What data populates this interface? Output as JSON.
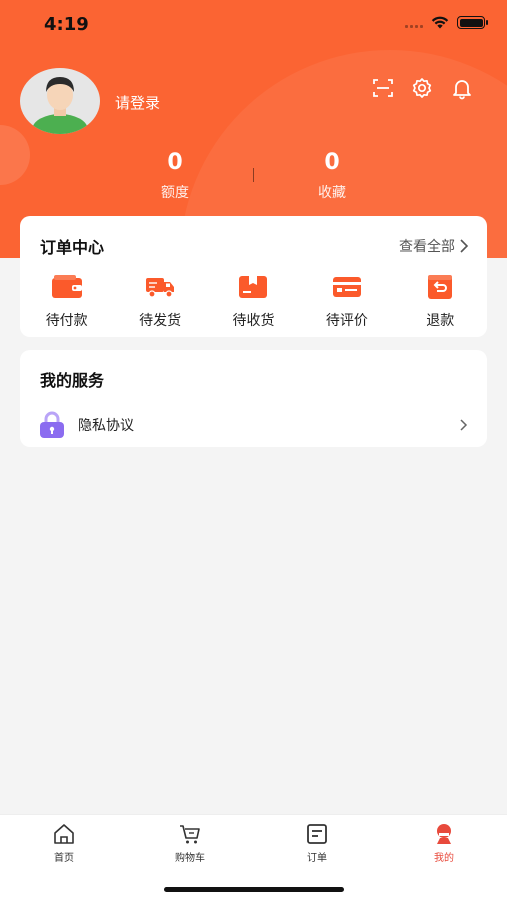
{
  "status_bar": {
    "time": "4:19"
  },
  "profile": {
    "login_text": "请登录",
    "stats": [
      {
        "value": "0",
        "label": "额度"
      },
      {
        "value": "0",
        "label": "收藏"
      }
    ]
  },
  "orders": {
    "title": "订单中心",
    "view_all": "查看全部",
    "items": [
      {
        "label": "待付款",
        "icon": "wallet-icon"
      },
      {
        "label": "待发货",
        "icon": "truck-icon"
      },
      {
        "label": "待收货",
        "icon": "package-icon"
      },
      {
        "label": "待评价",
        "icon": "review-card-icon"
      },
      {
        "label": "退款",
        "icon": "refund-icon"
      }
    ]
  },
  "services": {
    "title": "我的服务",
    "items": [
      {
        "label": "隐私协议",
        "icon": "lock-icon"
      }
    ]
  },
  "tabbar": {
    "items": [
      {
        "label": "首页",
        "icon": "home-icon"
      },
      {
        "label": "购物车",
        "icon": "cart-icon"
      },
      {
        "label": "订单",
        "icon": "order-doc-icon"
      },
      {
        "label": "我的",
        "icon": "profile-icon",
        "active": true
      }
    ]
  },
  "colors": {
    "brand": "#fb6433",
    "active_tab": "#e84a3c",
    "lock": "#8b6cf0"
  }
}
